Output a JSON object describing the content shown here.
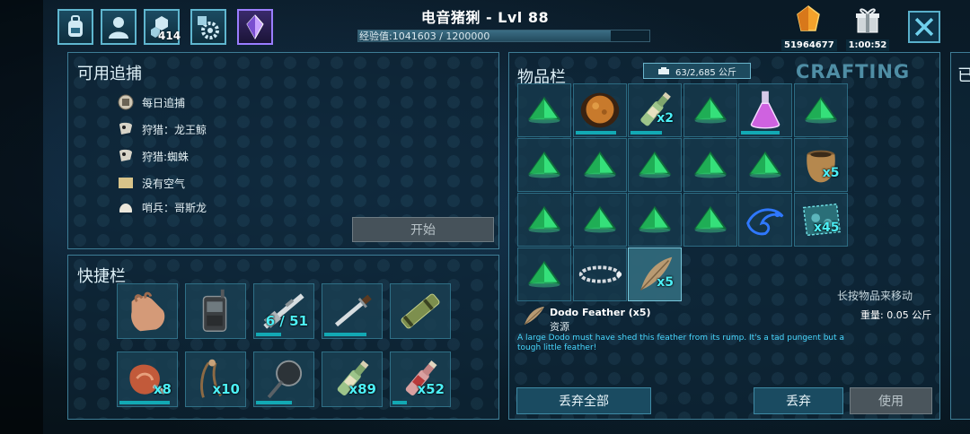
{
  "header": {
    "title": "电音猪猁 - Lvl 88",
    "xp_text": "经验值:1041603 / 1200000",
    "xp_progress": 0.868,
    "tab_count": "414",
    "resource_amber": "51964677",
    "resource_timer": "1:00:52"
  },
  "tracking": {
    "title": "可用追捕",
    "items": [
      "每日追捕",
      "狩猎：龙王鲸",
      "狩猎:蜘蛛",
      "没有空气",
      "哨兵：哥斯龙"
    ],
    "start_label": "开始"
  },
  "hotbar": {
    "title": "快捷栏",
    "slots": [
      {
        "icon": "hand-icon",
        "count": "",
        "durability": 0
      },
      {
        "icon": "radio-icon",
        "count": "",
        "durability": 0
      },
      {
        "icon": "rifle-icon",
        "count": "6 / 51",
        "durability": 0.45
      },
      {
        "icon": "sword-icon",
        "count": "",
        "durability": 0.75
      },
      {
        "icon": "spyglass-icon",
        "count": "",
        "durability": 0
      },
      {
        "icon": "meat-icon",
        "count": "x8",
        "durability": 0.9
      },
      {
        "icon": "whip-icon",
        "count": "x10",
        "durability": 0
      },
      {
        "icon": "frying-pan-icon",
        "count": "",
        "durability": 0.65
      },
      {
        "icon": "bottle-icon",
        "count": "x89",
        "durability": 0
      },
      {
        "icon": "red-bottle-icon",
        "count": "x52",
        "durability": 0.25
      }
    ]
  },
  "inventory": {
    "title": "物品栏",
    "weight": "63/2,685 公斤",
    "crafting_tab": "CRAFTING",
    "hint": "长按物品来移动",
    "slots": [
      {
        "icon": "pyramid-icon",
        "count": "",
        "durability": 0
      },
      {
        "icon": "stew-bowl-icon",
        "count": "",
        "durability": 0.85
      },
      {
        "icon": "bottle-icon",
        "count": "x2",
        "durability": 0.65
      },
      {
        "icon": "pyramid-icon",
        "count": "",
        "durability": 0
      },
      {
        "icon": "potion-flask-icon",
        "count": "",
        "durability": 0.8
      },
      {
        "icon": "pyramid-icon",
        "count": "",
        "durability": 0
      },
      {
        "icon": "pyramid-icon",
        "count": "",
        "durability": 0
      },
      {
        "icon": "pyramid-icon",
        "count": "",
        "durability": 0
      },
      {
        "icon": "pyramid-icon",
        "count": "",
        "durability": 0
      },
      {
        "icon": "pyramid-icon",
        "count": "",
        "durability": 0
      },
      {
        "icon": "pyramid-icon",
        "count": "",
        "durability": 0
      },
      {
        "icon": "clay-pot-icon",
        "count": "x5",
        "durability": 0
      },
      {
        "icon": "pyramid-icon",
        "count": "",
        "durability": 0
      },
      {
        "icon": "pyramid-icon",
        "count": "",
        "durability": 0
      },
      {
        "icon": "pyramid-icon",
        "count": "",
        "durability": 0
      },
      {
        "icon": "pyramid-icon",
        "count": "",
        "durability": 0
      },
      {
        "icon": "blue-creature-icon",
        "count": "",
        "durability": 0
      },
      {
        "icon": "hide-icon",
        "count": "x45",
        "durability": 0
      },
      {
        "icon": "pyramid-icon",
        "count": "",
        "durability": 0
      },
      {
        "icon": "collar-icon",
        "count": "",
        "durability": 0
      },
      {
        "icon": "feather-icon",
        "count": "x5",
        "durability": 0
      }
    ],
    "selected": {
      "name": "Dodo Feather (x5)",
      "type": "资源",
      "weight": "重量: 0.05 公斤",
      "description": "A large Dodo must have shed this feather from its rump. It's a tad pungent but a tough little feather!"
    },
    "drop_all_label": "丢弃全部",
    "drop_label": "丢弃",
    "use_label": "使用"
  },
  "side_tab_glyph": "已"
}
